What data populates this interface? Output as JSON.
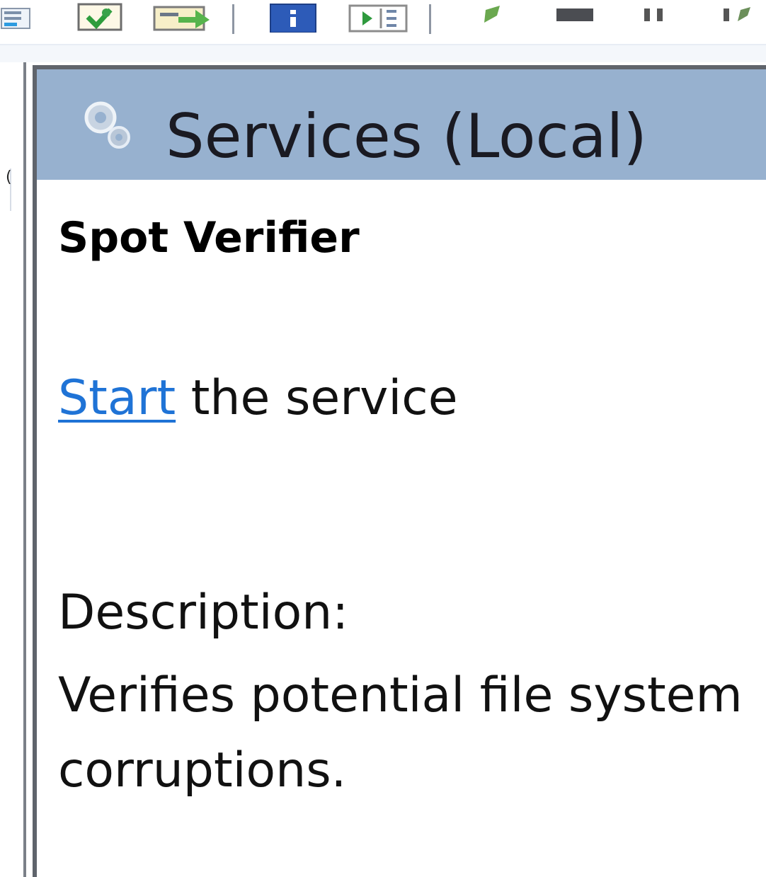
{
  "toolbar": {
    "buttons": [
      {
        "name": "show-hide-tree-button",
        "icon": "tree-pane-icon"
      },
      {
        "name": "export-list-button",
        "icon": "export-icon"
      },
      {
        "name": "connect-button",
        "icon": "connect-icon"
      },
      {
        "name": "help-button",
        "icon": "help-icon"
      },
      {
        "name": "start-service-button",
        "icon": "play-icon"
      },
      {
        "name": "edit-button",
        "icon": "edit-icon"
      },
      {
        "name": "stop-service-button",
        "icon": "stop-icon"
      },
      {
        "name": "pause-service-button",
        "icon": "pause-icon"
      },
      {
        "name": "restart-service-button",
        "icon": "restart-icon"
      }
    ]
  },
  "left_pane": {
    "tab_glyph": "("
  },
  "header": {
    "title": "Services (Local)",
    "icon": "gears-icon",
    "background": "#97b1cf"
  },
  "details": {
    "service_name": "Spot Verifier",
    "start_link": "Start",
    "start_suffix": " the service",
    "description_label": "Description:",
    "description_text": "Verifies potential file system corruptions.",
    "link_color": "#1f73d6"
  }
}
